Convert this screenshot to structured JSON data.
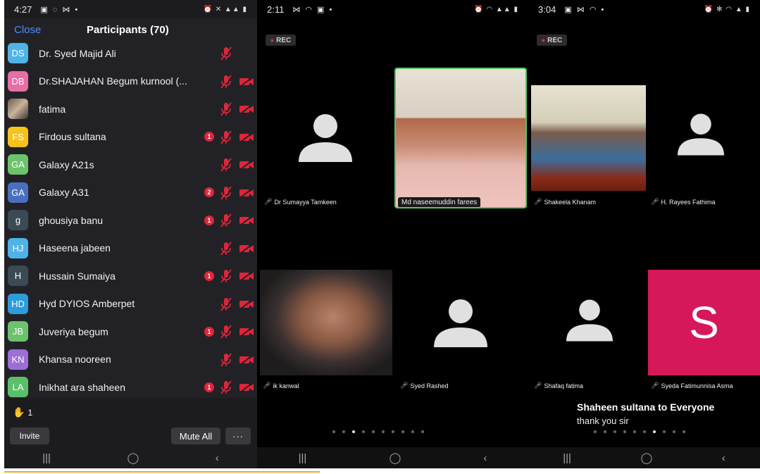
{
  "panel1": {
    "status_time": "4:27",
    "close_label": "Close",
    "title": "Participants (70)",
    "participants": [
      {
        "initials": "DS",
        "name": "Dr. Syed Majid Ali",
        "color": "#4fb3e8",
        "badge": "",
        "cam_off": false
      },
      {
        "initials": "DB",
        "name": "Dr.SHAJAHAN Begum kurnool (...",
        "color": "#e86ea6",
        "badge": "",
        "cam_off": true
      },
      {
        "initials": "",
        "name": "fatima",
        "color": "",
        "badge": "",
        "cam_off": true
      },
      {
        "initials": "FS",
        "name": "Firdous sultana",
        "color": "#f6c31c",
        "badge": "1",
        "cam_off": true
      },
      {
        "initials": "GA",
        "name": "Galaxy A21s",
        "color": "#6cc36c",
        "badge": "",
        "cam_off": true
      },
      {
        "initials": "GA",
        "name": "Galaxy A31",
        "color": "#4a6fbf",
        "badge": "2",
        "cam_off": true
      },
      {
        "initials": "g",
        "name": "ghousiya banu",
        "color": "#3b4a55",
        "badge": "1",
        "cam_off": true
      },
      {
        "initials": "HJ",
        "name": "Haseena jabeen",
        "color": "#4fb3e8",
        "badge": "",
        "cam_off": true
      },
      {
        "initials": "H",
        "name": "Hussain Sumaiya",
        "color": "#3b4a55",
        "badge": "1",
        "cam_off": true
      },
      {
        "initials": "HD",
        "name": "Hyd DYIOS Amberpet",
        "color": "#2d9cdb",
        "badge": "",
        "cam_off": true
      },
      {
        "initials": "JB",
        "name": "Juveriya begum",
        "color": "#6cc36c",
        "badge": "1",
        "cam_off": true
      },
      {
        "initials": "KN",
        "name": "Khansa nooreen",
        "color": "#9b6fd6",
        "badge": "",
        "cam_off": true
      },
      {
        "initials": "LA",
        "name": "Inikhat ara shaheen",
        "color": "#5bbf6a",
        "badge": "1",
        "cam_off": true
      }
    ],
    "raised_hands": "1",
    "invite_label": "Invite",
    "mute_all_label": "Mute All",
    "more_label": "···"
  },
  "panel2": {
    "status_time": "2:11",
    "rec_label": "REC",
    "tiles": [
      {
        "name": "Dr Sumayya Tamkeen"
      },
      {
        "name": "Md naseemuddin farees"
      },
      {
        "name": "ik kanwal"
      },
      {
        "name": "Syed Rashed"
      }
    ],
    "page_count": 10,
    "active_page": 2
  },
  "panel3": {
    "status_time": "3:04",
    "rec_label": "REC",
    "tiles": [
      {
        "name": "Shakeela Khanam"
      },
      {
        "name": "H. Rayees Fathima"
      },
      {
        "name": "Shafaq fatima"
      },
      {
        "name": "Syeda Fatimunnisa Asma",
        "initial": "S"
      }
    ],
    "chat_from": "Shaheen sultana to Everyone",
    "chat_message": "thank you sir",
    "page_count": 10,
    "active_page": 6
  },
  "nav": {
    "recents": "|||",
    "home": "◯",
    "back": "‹"
  },
  "colors": {
    "highlight": "#57c466",
    "mute_red": "#e0253a",
    "link_blue": "#4a8cff",
    "s_tile": "#d6185a"
  }
}
